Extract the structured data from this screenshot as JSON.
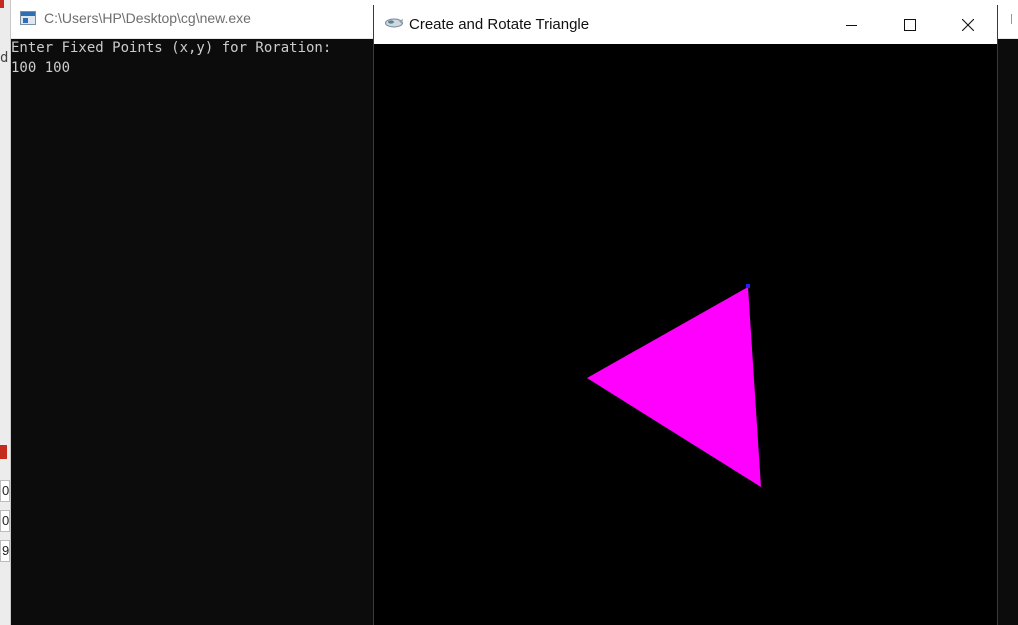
{
  "background_app": {
    "fragment_letter": "d",
    "cells": [
      "0",
      "0",
      "9"
    ]
  },
  "console": {
    "title": "C:\\Users\\HP\\Desktop\\cg\\new.exe",
    "lines": [
      "Enter Fixed Points (x,y) for Roration:",
      "100 100"
    ],
    "icon": "console-app-icon"
  },
  "gl_window": {
    "title": "Create and Rotate Triangle",
    "icon": "opengl-app-icon",
    "controls": {
      "minimize": "minimize-icon",
      "maximize": "maximize-icon",
      "close": "close-icon"
    },
    "triangle_fill": "#ff00ff",
    "vertex_marker": "#1f1fff",
    "canvas_bg": "#000000"
  }
}
